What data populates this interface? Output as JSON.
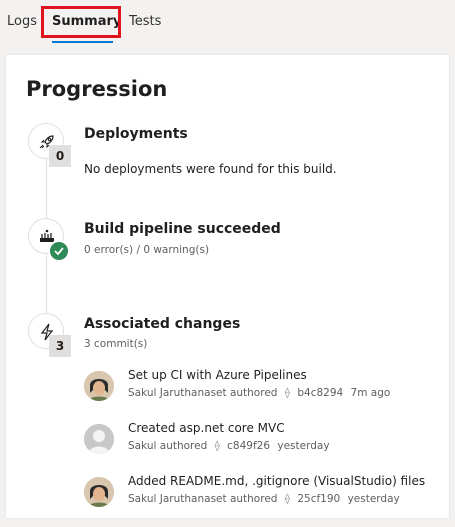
{
  "tabs": [
    {
      "label": "Logs"
    },
    {
      "label": "Summary"
    },
    {
      "label": "Tests"
    }
  ],
  "card": {
    "title": "Progression",
    "deployments": {
      "title": "Deployments",
      "count": "0",
      "message": "No deployments were found for this build."
    },
    "build": {
      "title": "Build pipeline succeeded",
      "status": "0 error(s) / 0 warning(s)"
    },
    "changes": {
      "title": "Associated changes",
      "count": "3",
      "summary": "3 commit(s)",
      "commits": [
        {
          "message": "Set up CI with Azure Pipelines",
          "author": "Sakul Jaruthanaset authored",
          "hash": "b4c8294",
          "time": "7m ago"
        },
        {
          "message": "Created asp.net core MVC",
          "author": "Sakul authored",
          "hash": "c849f26",
          "time": "yesterday"
        },
        {
          "message": "Added README.md, .gitignore (VisualStudio) files",
          "author": "Sakul Jaruthanaset authored",
          "hash": "25cf190",
          "time": "yesterday"
        }
      ]
    }
  },
  "icons": {
    "deployments": "rocket-icon",
    "build": "pipeline-icon",
    "changes": "lightning-icon",
    "commit": "commit-icon"
  },
  "colors": {
    "accent": "#0078d4",
    "success": "#2e8b57",
    "highlight": "#e0141e"
  }
}
